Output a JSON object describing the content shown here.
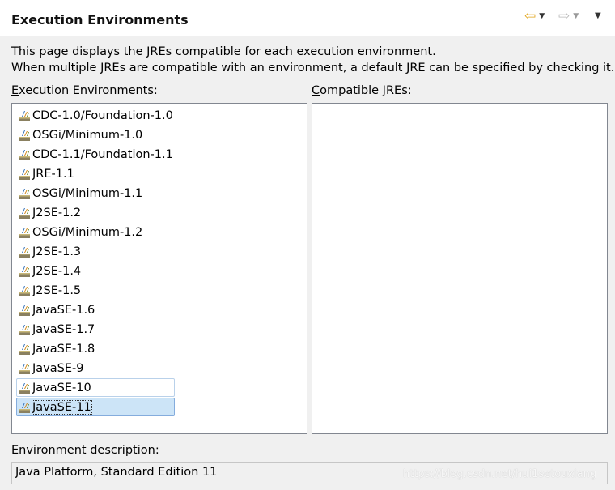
{
  "header": {
    "title": "Execution Environments",
    "back_icon": "back-arrow-icon",
    "forward_icon": "forward-arrow-icon",
    "menu_icon": "view-menu-icon"
  },
  "description": {
    "line1": "This page displays the JREs compatible for each execution environment.",
    "line2": "When multiple JREs are compatible with an environment, a default JRE can be specified by checking it."
  },
  "env_label": {
    "mnemonic": "E",
    "rest": "xecution Environments:"
  },
  "jre_label": {
    "mnemonic": "C",
    "rest": "ompatible JREs:"
  },
  "environments": [
    {
      "label": "CDC-1.0/Foundation-1.0"
    },
    {
      "label": "OSGi/Minimum-1.0"
    },
    {
      "label": "CDC-1.1/Foundation-1.1"
    },
    {
      "label": "JRE-1.1"
    },
    {
      "label": "OSGi/Minimum-1.1"
    },
    {
      "label": "J2SE-1.2"
    },
    {
      "label": "OSGi/Minimum-1.2"
    },
    {
      "label": "J2SE-1.3"
    },
    {
      "label": "J2SE-1.4"
    },
    {
      "label": "J2SE-1.5"
    },
    {
      "label": "JavaSE-1.6"
    },
    {
      "label": "JavaSE-1.7"
    },
    {
      "label": "JavaSE-1.8"
    },
    {
      "label": "JavaSE-9"
    },
    {
      "label": "JavaSE-10",
      "state": "hover"
    },
    {
      "label": "JavaSE-11",
      "state": "selected"
    }
  ],
  "env_icon": "execution-environment-icon",
  "compatible_jres": [],
  "env_description": {
    "label": "Environment description:",
    "value": "Java Platform, Standard Edition 11"
  },
  "watermark": "https://blog.csdn.net/hui1setouxiang"
}
